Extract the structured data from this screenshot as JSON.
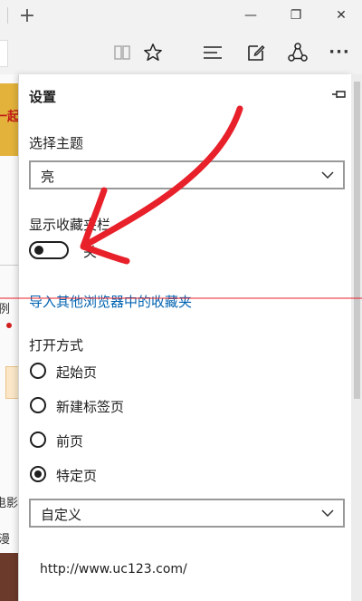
{
  "browser": {
    "new_tab_glyph": "+",
    "window_controls": {
      "minimize": "—",
      "restore": "❐",
      "close": "✕"
    },
    "toolbar_icons": [
      "reading-view-icon",
      "favorites-star-icon",
      "hub-icon",
      "web-note-icon",
      "share-icon",
      "more-icon"
    ],
    "more_glyph": "···"
  },
  "background_page": {
    "fragments": [
      "一起",
      "例",
      "电影",
      "漫"
    ]
  },
  "settings": {
    "title": "设置",
    "pin_glyph": "⊣",
    "theme": {
      "label": "选择主题",
      "value": "亮"
    },
    "favorites_bar": {
      "label": "显示收藏夹栏",
      "toggle_state": "关",
      "toggle_on": false
    },
    "import_link": "导入其他浏览器中的收藏夹",
    "open_with": {
      "label": "打开方式",
      "options": [
        {
          "label": "起始页",
          "checked": false
        },
        {
          "label": "新建标签页",
          "checked": false
        },
        {
          "label": "前页",
          "checked": false
        },
        {
          "label": "特定页",
          "checked": true
        }
      ],
      "specific_select": "自定义",
      "url": "http://www.uc123.com/"
    }
  },
  "colors": {
    "link": "#0063b1",
    "annotation": "#e8202a",
    "toggle_off": "#1e1e1e"
  }
}
